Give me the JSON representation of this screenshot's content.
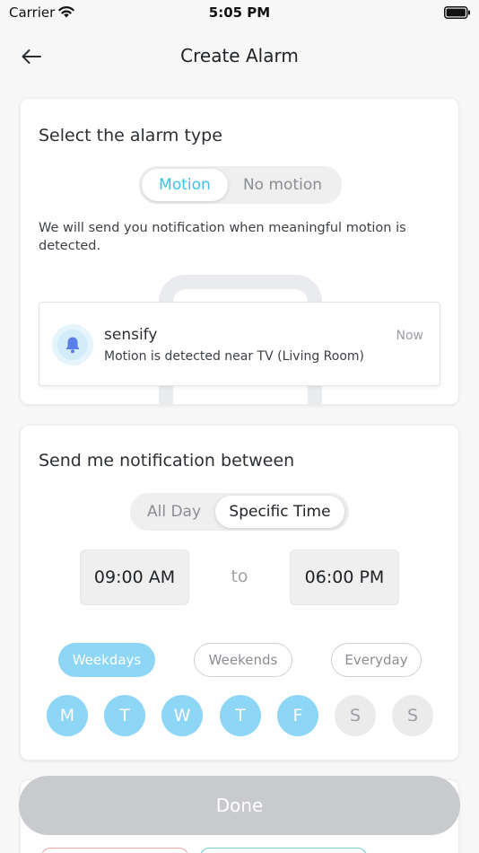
{
  "status_bar": {
    "carrier": "Carrier",
    "time": "5:05 PM"
  },
  "nav": {
    "title": "Create Alarm"
  },
  "alarm_type": {
    "title": "Select the alarm type",
    "options": [
      "Motion",
      "No motion"
    ],
    "selected": "Motion",
    "description": "We will send you notification when meaningful motion is detected.",
    "notification": {
      "app": "sensify",
      "time": "Now",
      "message": "Motion is detected near TV (Living Room)"
    }
  },
  "schedule": {
    "title": "Send me notification between",
    "options": [
      "All Day",
      "Specific Time"
    ],
    "selected": "Specific Time",
    "start_time": "09:00 AM",
    "separator": "to",
    "end_time": "06:00 PM",
    "presets": [
      "Weekdays",
      "Weekends",
      "Everyday"
    ],
    "selected_preset": "Weekdays",
    "days": [
      {
        "label": "M",
        "on": true
      },
      {
        "label": "T",
        "on": true
      },
      {
        "label": "W",
        "on": true
      },
      {
        "label": "T",
        "on": true
      },
      {
        "label": "F",
        "on": true
      },
      {
        "label": "S",
        "on": false
      },
      {
        "label": "S",
        "on": false
      }
    ]
  },
  "done_label": "Done",
  "colors": {
    "accent": "#3fc0ea",
    "day_on": "#8dd6f5",
    "day_off": "#ebebeb",
    "done_disabled": "#c8cacd",
    "peek_left_border": "#f2a5a5",
    "peek_right_border": "#6fd0ce"
  },
  "icons": [
    "wifi-icon",
    "battery-icon",
    "back-arrow-icon",
    "bell-icon"
  ]
}
